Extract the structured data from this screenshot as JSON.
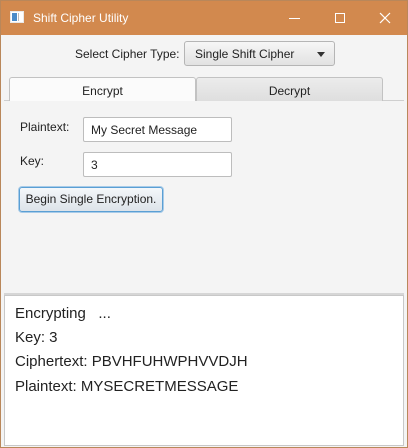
{
  "window": {
    "title": "Shift Cipher Utility"
  },
  "cipher_type": {
    "label": "Select Cipher Type:",
    "selected": "Single Shift Cipher"
  },
  "tabs": [
    {
      "label": "Encrypt",
      "active": true
    },
    {
      "label": "Decrypt",
      "active": false
    }
  ],
  "form": {
    "plaintext_label": "Plaintext:",
    "plaintext_value": "My Secret Message",
    "key_label": "Key:",
    "key_value": "3",
    "action_button": "Begin Single Encryption."
  },
  "output": {
    "lines": [
      "Encrypting   ...",
      "Key: 3",
      "Ciphertext: PBVHFUHWPHVVDJH",
      "Plaintext: MYSECRETMESSAGE"
    ]
  },
  "colors": {
    "titlebar": "#d2894e",
    "focus_border": "#5a9fd4"
  }
}
